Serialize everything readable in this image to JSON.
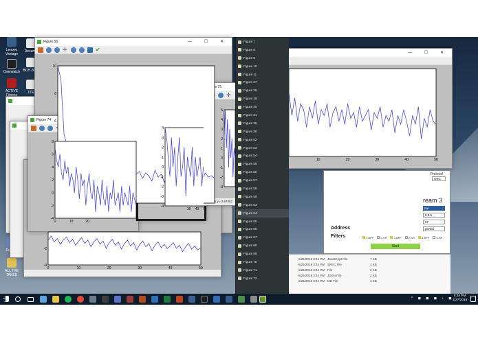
{
  "desktop": {
    "icons": [
      "Lenovo Vantage",
      "Overwatch",
      "ACTIVE Fitness",
      "Google Chrome",
      "Resume",
      "BCH 2018",
      "1TE",
      "Discord",
      "ALL THE TAKES"
    ]
  },
  "windows": {
    "fig56": {
      "title": "Figure 56"
    },
    "fig74": {
      "title": "Figure 74"
    },
    "fig71": {
      "title": "Figure 71"
    },
    "fig75": {
      "title": "Figure 75",
      "coord_x": "x=18.8516",
      "coord_y": "y=-2.97362"
    }
  },
  "figure_list": [
    "Figure 7",
    "Figure 8",
    "Figure 9",
    "Figure 10",
    "Figure 11",
    "Figure 27",
    "Figure 28",
    "Figure 29",
    "Figure 30",
    "Figure 31",
    "Figure 35",
    "Figure 36",
    "Figure 52",
    "Figure 53",
    "Figure 54",
    "Figure 55",
    "Figure 56",
    "Figure 57",
    "Figure 58",
    "Figure 59",
    "Figure 63",
    "Figure 64",
    "Figure 65",
    "Figure 66",
    "Figure 67",
    "Figure 68",
    "Figure 69",
    "Figure 70",
    "Figure 71",
    "Figure 72"
  ],
  "selected_figure": "Figure 64",
  "stream": {
    "protocol_label": "Protocol",
    "protocol_value": "OSC",
    "title": "ream 3",
    "name_field": "me",
    "address_field": "0.0.5",
    "port_field": "67",
    "host_field": "penbci",
    "address_label": "Address",
    "filters_label": "Filters",
    "filters": [
      "1-BPF",
      "2-SR",
      "2-BPF",
      "2-SR",
      "3-BPF",
      "3-SR"
    ],
    "start_label": "Start"
  },
  "files": [
    {
      "date": "6/25/2018 3:34 PM",
      "type": "JavaScript File",
      "size": "7 KB"
    },
    {
      "date": "6/25/2018 3:34 PM",
      "type": "SPEC File",
      "size": "1 KB"
    },
    {
      "date": "6/25/2018 3:34 PM",
      "type": "File",
      "size": "2 KB"
    },
    {
      "date": "6/25/2018 3:34 PM",
      "type": "JSON File",
      "size": "2 KB"
    },
    {
      "date": "6/25/2018 3:34 PM",
      "type": "MD File",
      "size": "1 KB"
    }
  ],
  "taskbar": {
    "time": "5:34 PM",
    "date": "1/27/2018"
  },
  "colors": {
    "plot_line": "#4a4adc",
    "desktop_top": "#16283f",
    "taskbar": "#0f1c2b",
    "list_panel": "#2c3436"
  },
  "chart_data": [
    {
      "type": "line",
      "window": "Figure 56",
      "x": [
        0,
        1,
        2,
        3,
        4,
        5,
        6,
        7,
        8,
        9,
        10,
        11,
        12,
        13,
        14,
        15,
        16,
        17,
        18,
        19,
        20,
        21,
        22,
        23,
        24,
        25,
        26,
        27,
        28,
        29,
        30,
        31,
        32,
        33,
        34,
        35,
        36,
        37,
        38,
        39,
        40,
        41,
        42,
        43,
        44,
        45,
        46,
        47,
        48,
        49,
        50
      ],
      "y": [
        10,
        9,
        5,
        4.2,
        3.8,
        3.3,
        3.5,
        3.1,
        2.6,
        2.9,
        2.3,
        2.7,
        2.2,
        2.5,
        2.0,
        2.6,
        1.8,
        2.3,
        2.0,
        2.4,
        1.9,
        2.2,
        2.0,
        2.5,
        1.7,
        2.1,
        2.3,
        1.8,
        2.2,
        2.0,
        1.6,
        2.4,
        1.9,
        2.1,
        1.5,
        2.3,
        1.8,
        2.0,
        2.2,
        1.7,
        2.1,
        1.9,
        2.3,
        1.8,
        2.0,
        2.1,
        1.6,
        2.2,
        1.9,
        2.0,
        1.8
      ],
      "xlim": [
        0,
        50
      ],
      "ylim": [
        0,
        10
      ],
      "yticks": [
        2,
        4,
        6,
        8,
        10
      ]
    },
    {
      "type": "line",
      "window": "Figure 74",
      "x": [
        0,
        1,
        2,
        3,
        4,
        5,
        6,
        7,
        8,
        9,
        10,
        11,
        12,
        13,
        14,
        15,
        16,
        17,
        18,
        19,
        20,
        21,
        22,
        23,
        24,
        25,
        26,
        27,
        28,
        29,
        30,
        31,
        32,
        33,
        34,
        35,
        36,
        37,
        38,
        39,
        40,
        41,
        42,
        43,
        44,
        45,
        46,
        47,
        48,
        49,
        50
      ],
      "y": [
        7,
        5,
        4,
        6,
        3,
        2,
        5,
        3,
        4,
        1,
        3,
        2,
        0,
        4,
        2,
        -1,
        3,
        1,
        2,
        -2,
        1,
        3,
        0,
        -1,
        2,
        -3,
        1,
        0,
        -2,
        2,
        -1,
        -2,
        1,
        -3,
        0,
        -1,
        2,
        -2,
        -1,
        0,
        -3,
        1,
        -2,
        0,
        -1,
        -2,
        1,
        -3,
        0,
        -1,
        -2
      ],
      "xlim": [
        0,
        50
      ],
      "ylim": [
        -4,
        8
      ],
      "xticks": [
        0,
        10,
        20
      ],
      "yticks": [
        -4,
        -2,
        0,
        2,
        4,
        6,
        8
      ]
    },
    {
      "type": "line",
      "window": "Figure 71",
      "x": [
        0,
        2,
        4,
        6,
        8,
        10,
        12,
        14,
        16,
        18,
        20,
        22,
        24,
        26,
        28,
        30,
        32,
        34,
        36,
        38,
        40,
        42,
        44,
        46,
        48,
        50
      ],
      "y": [
        4,
        3,
        1,
        -1,
        3,
        0,
        2,
        -2,
        1,
        3,
        -1,
        0,
        2,
        -3,
        1,
        0,
        -1,
        2,
        -2,
        1,
        -1,
        0,
        1,
        -2,
        0,
        -1
      ],
      "xlim": [
        0,
        50
      ],
      "ylim": [
        -4,
        4
      ],
      "xticks": [
        30,
        40,
        50
      ],
      "yticks": [
        -4,
        -3,
        -2,
        -1,
        0,
        1,
        2,
        3,
        4
      ]
    },
    {
      "type": "line",
      "window": "Figure 75",
      "x": [
        0,
        2,
        4,
        6,
        8,
        10,
        12,
        14,
        16,
        18,
        20
      ],
      "y": [
        2,
        5,
        1,
        4,
        -1,
        3,
        0,
        2,
        -2,
        1,
        0
      ],
      "xlim": [
        0,
        20
      ],
      "ylim": [
        -3,
        5
      ],
      "yticks": [
        -3,
        -2,
        -1,
        0,
        1,
        2,
        3,
        4,
        5
      ]
    },
    {
      "type": "line",
      "window": "background-right",
      "x": [
        0,
        1,
        2,
        3,
        4,
        5,
        6,
        7,
        8,
        9,
        10,
        11,
        12,
        13,
        14,
        15,
        16,
        17,
        18,
        19,
        20,
        21,
        22,
        23,
        24,
        25,
        26,
        27,
        28,
        29,
        30,
        31,
        32,
        33,
        34,
        35,
        36,
        37,
        38,
        39,
        40,
        41,
        42,
        43,
        44,
        45,
        46,
        47,
        48,
        49,
        50
      ],
      "y": [
        0.6,
        0.2,
        0.5,
        0.1,
        0.4,
        0.3,
        0.0,
        0.35,
        0.15,
        0.45,
        0.05,
        0.3,
        0.2,
        0.4,
        0.0,
        0.25,
        0.35,
        0.1,
        0.3,
        0.05,
        0.4,
        0.15,
        0.25,
        0.0,
        0.35,
        0.1,
        0.2,
        0.3,
        -0.05,
        0.25,
        0.15,
        0.35,
        0.0,
        0.2,
        0.1,
        0.3,
        -0.1,
        0.2,
        0.05,
        0.3,
        0.1,
        -0.15,
        0.2,
        0.05,
        0.35,
        -0.2,
        0.15,
        0.0,
        0.3,
        0.1,
        0.05
      ],
      "xlim": [
        0,
        50
      ],
      "ylim": [
        -0.5,
        1.0
      ],
      "xticks": [
        10,
        20,
        30,
        40,
        50
      ]
    },
    {
      "type": "line",
      "window": "background-bottom",
      "x": [
        0,
        1,
        2,
        3,
        4,
        5,
        6,
        7,
        8,
        9,
        10,
        11,
        12,
        13,
        14,
        15,
        16,
        17,
        18,
        19,
        20,
        21,
        22,
        23,
        24,
        25,
        26,
        27,
        28,
        29,
        30,
        31,
        32,
        33,
        34,
        35,
        36,
        37,
        38,
        39,
        40,
        41,
        42,
        43,
        44,
        45,
        46,
        47,
        48,
        49,
        50
      ],
      "y": [
        -1,
        -0.5,
        -1.2,
        -0.8,
        -1.5,
        -1.0,
        -0.6,
        -1.3,
        -0.9,
        -1.6,
        -1.1,
        -0.7,
        -1.4,
        -1.0,
        -1.8,
        -1.2,
        -0.8,
        -1.5,
        -1.1,
        -2.0,
        -1.3,
        -0.9,
        -1.6,
        -1.2,
        -2.1,
        -1.4,
        -1.0,
        -1.7,
        -1.3,
        -2.2,
        -1.5,
        -1.1,
        -1.8,
        -1.4,
        -2.3,
        -1.6,
        -1.2,
        -1.9,
        -1.5,
        -2.0,
        -1.7,
        -1.3,
        -2.0,
        -1.6,
        -2.4,
        -1.8,
        -1.4,
        -2.1,
        -1.7,
        -2.2,
        -1.9
      ],
      "xlim": [
        0,
        50
      ],
      "ylim": [
        -4,
        0
      ],
      "xticks": [
        0,
        10,
        20,
        30,
        40,
        50
      ],
      "yticks": [
        -4,
        -2
      ]
    }
  ]
}
